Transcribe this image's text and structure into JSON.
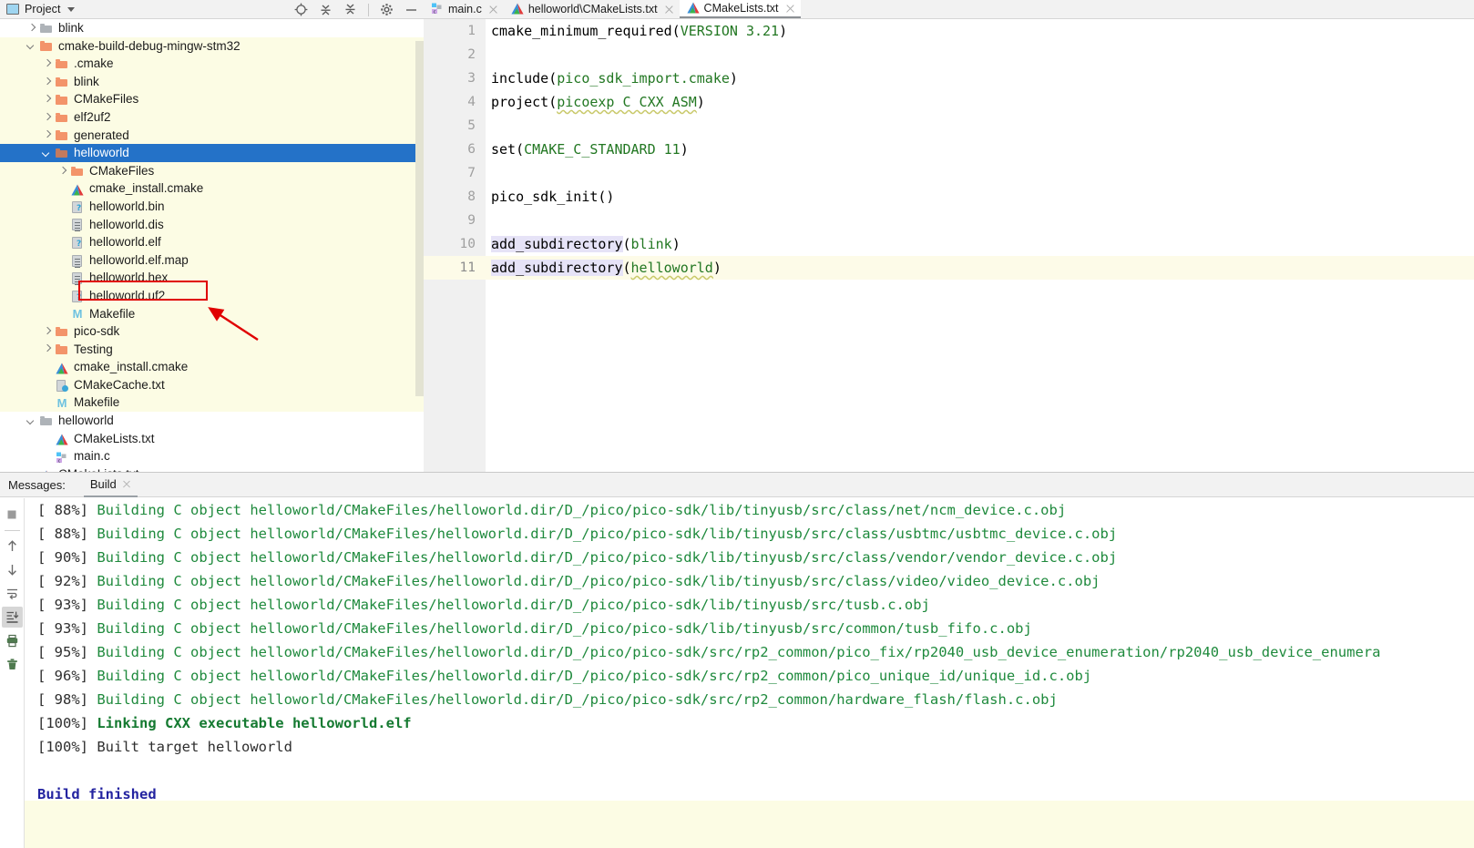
{
  "project_panel": {
    "title": "Project",
    "icons": [
      "project-window-icon",
      "chevron-down-icon",
      "locate-icon",
      "expand-all-icon",
      "collapse-all-icon",
      "gear-icon",
      "minimize-icon"
    ],
    "tree": [
      {
        "label": "blink",
        "icon": "folder-gray",
        "indent": 1,
        "arrow": "right",
        "state": "normal"
      },
      {
        "label": "cmake-build-debug-mingw-stm32",
        "icon": "folder-orange",
        "indent": 1,
        "arrow": "down",
        "state": "shaded"
      },
      {
        "label": ".cmake",
        "icon": "folder-orange",
        "indent": 2,
        "arrow": "right",
        "state": "shaded"
      },
      {
        "label": "blink",
        "icon": "folder-orange",
        "indent": 2,
        "arrow": "right",
        "state": "shaded"
      },
      {
        "label": "CMakeFiles",
        "icon": "folder-orange",
        "indent": 2,
        "arrow": "right",
        "state": "shaded"
      },
      {
        "label": "elf2uf2",
        "icon": "folder-orange",
        "indent": 2,
        "arrow": "right",
        "state": "shaded"
      },
      {
        "label": "generated",
        "icon": "folder-orange",
        "indent": 2,
        "arrow": "right",
        "state": "shaded"
      },
      {
        "label": "helloworld",
        "icon": "folder-dim",
        "indent": 2,
        "arrow": "down",
        "state": "selected"
      },
      {
        "label": "CMakeFiles",
        "icon": "folder-orange",
        "indent": 3,
        "arrow": "right",
        "state": "shaded"
      },
      {
        "label": "cmake_install.cmake",
        "icon": "cmake-file-icon",
        "indent": 3,
        "arrow": "none",
        "state": "shaded"
      },
      {
        "label": "helloworld.bin",
        "icon": "unknown-file-icon",
        "indent": 3,
        "arrow": "none",
        "state": "shaded"
      },
      {
        "label": "helloworld.dis",
        "icon": "text-file-icon",
        "indent": 3,
        "arrow": "none",
        "state": "shaded"
      },
      {
        "label": "helloworld.elf",
        "icon": "unknown-file-icon",
        "indent": 3,
        "arrow": "none",
        "state": "shaded"
      },
      {
        "label": "helloworld.elf.map",
        "icon": "text-file-icon",
        "indent": 3,
        "arrow": "none",
        "state": "shaded"
      },
      {
        "label": "helloworld.hex",
        "icon": "text-file-icon",
        "indent": 3,
        "arrow": "none",
        "state": "shaded"
      },
      {
        "label": "helloworld.uf2",
        "icon": "unknown-file-icon",
        "indent": 3,
        "arrow": "none",
        "state": "shaded",
        "highlighted": true
      },
      {
        "label": "Makefile",
        "icon": "makefile-icon",
        "indent": 3,
        "arrow": "none",
        "state": "shaded"
      },
      {
        "label": "pico-sdk",
        "icon": "folder-orange",
        "indent": 2,
        "arrow": "right",
        "state": "shaded"
      },
      {
        "label": "Testing",
        "icon": "folder-orange",
        "indent": 2,
        "arrow": "right",
        "state": "shaded"
      },
      {
        "label": "cmake_install.cmake",
        "icon": "cmake-file-icon",
        "indent": 2,
        "arrow": "none",
        "state": "shaded"
      },
      {
        "label": "CMakeCache.txt",
        "icon": "cmake-cache-icon",
        "indent": 2,
        "arrow": "none",
        "state": "shaded"
      },
      {
        "label": "Makefile",
        "icon": "makefile-icon",
        "indent": 2,
        "arrow": "none",
        "state": "shaded"
      },
      {
        "label": "helloworld",
        "icon": "folder-gray",
        "indent": 1,
        "arrow": "down",
        "state": "normal"
      },
      {
        "label": "CMakeLists.txt",
        "icon": "cmake-file-icon",
        "indent": 2,
        "arrow": "none",
        "state": "normal"
      },
      {
        "label": "main.c",
        "icon": "c-file-icon",
        "indent": 2,
        "arrow": "none",
        "state": "normal"
      },
      {
        "label": "CMakeLists.txt",
        "icon": "cmake-file-icon",
        "indent": 1,
        "arrow": "none",
        "state": "normal"
      }
    ],
    "annotation": {
      "type": "red-arrow-pointing-to-uf2",
      "color": "#e00000"
    }
  },
  "editor": {
    "tabs": [
      {
        "label": "main.c",
        "icon": "c-file-icon",
        "active": false
      },
      {
        "label": "helloworld\\CMakeLists.txt",
        "icon": "cmake-file-icon",
        "active": false
      },
      {
        "label": "CMakeLists.txt",
        "icon": "cmake-file-icon",
        "active": true
      }
    ],
    "current_line": 11,
    "lines": [
      {
        "n": "1",
        "tokens": [
          {
            "t": "cmake_minimum_required(",
            "c": "plain"
          },
          {
            "t": "VERSION 3.21",
            "c": "green"
          },
          {
            "t": ")",
            "c": "plain"
          }
        ]
      },
      {
        "n": "2",
        "tokens": []
      },
      {
        "n": "3",
        "tokens": [
          {
            "t": "include(",
            "c": "plain"
          },
          {
            "t": "pico_sdk_import.cmake",
            "c": "green"
          },
          {
            "t": ")",
            "c": "plain"
          }
        ]
      },
      {
        "n": "4",
        "tokens": [
          {
            "t": "project(",
            "c": "plain"
          },
          {
            "t": "picoexp C CXX ASM",
            "c": "green-squiggle"
          },
          {
            "t": ")",
            "c": "plain"
          }
        ]
      },
      {
        "n": "5",
        "tokens": []
      },
      {
        "n": "6",
        "tokens": [
          {
            "t": "set(",
            "c": "plain"
          },
          {
            "t": "CMAKE_C_STANDARD 11",
            "c": "green"
          },
          {
            "t": ")",
            "c": "plain"
          }
        ]
      },
      {
        "n": "7",
        "tokens": []
      },
      {
        "n": "8",
        "tokens": [
          {
            "t": "pico_sdk_init()",
            "c": "plain"
          }
        ]
      },
      {
        "n": "9",
        "tokens": []
      },
      {
        "n": "10",
        "tokens": [
          {
            "t": "add_subdirectory",
            "c": "plain-hl"
          },
          {
            "t": "(",
            "c": "plain"
          },
          {
            "t": "blink",
            "c": "green"
          },
          {
            "t": ")",
            "c": "plain"
          }
        ]
      },
      {
        "n": "11",
        "tokens": [
          {
            "t": "add_subdirectory",
            "c": "plain-hl"
          },
          {
            "t": "(",
            "c": "plain"
          },
          {
            "t": "helloworld",
            "c": "green-squiggle"
          },
          {
            "t": ")",
            "c": "plain"
          }
        ]
      }
    ]
  },
  "messages_panel": {
    "label": "Messages:",
    "tab": "Build",
    "toolbar_icons": [
      "stop-icon",
      "up-arrow-icon",
      "down-arrow-icon",
      "soft-wrap-icon",
      "scroll-to-end-icon",
      "print-icon",
      "delete-icon"
    ],
    "log": [
      {
        "pct": "[ 88%]",
        "body": "Building C object helloworld/CMakeFiles/helloworld.dir/D_/pico/pico-sdk/lib/tinyusb/src/class/net/ncm_device.c.obj",
        "style": "green"
      },
      {
        "pct": "[ 88%]",
        "body": "Building C object helloworld/CMakeFiles/helloworld.dir/D_/pico/pico-sdk/lib/tinyusb/src/class/usbtmc/usbtmc_device.c.obj",
        "style": "green"
      },
      {
        "pct": "[ 90%]",
        "body": "Building C object helloworld/CMakeFiles/helloworld.dir/D_/pico/pico-sdk/lib/tinyusb/src/class/vendor/vendor_device.c.obj",
        "style": "green"
      },
      {
        "pct": "[ 92%]",
        "body": "Building C object helloworld/CMakeFiles/helloworld.dir/D_/pico/pico-sdk/lib/tinyusb/src/class/video/video_device.c.obj",
        "style": "green"
      },
      {
        "pct": "[ 93%]",
        "body": "Building C object helloworld/CMakeFiles/helloworld.dir/D_/pico/pico-sdk/lib/tinyusb/src/tusb.c.obj",
        "style": "green"
      },
      {
        "pct": "[ 93%]",
        "body": "Building C object helloworld/CMakeFiles/helloworld.dir/D_/pico/pico-sdk/lib/tinyusb/src/common/tusb_fifo.c.obj",
        "style": "green"
      },
      {
        "pct": "[ 95%]",
        "body": "Building C object helloworld/CMakeFiles/helloworld.dir/D_/pico/pico-sdk/src/rp2_common/pico_fix/rp2040_usb_device_enumeration/rp2040_usb_device_enumera",
        "style": "green"
      },
      {
        "pct": "[ 96%]",
        "body": "Building C object helloworld/CMakeFiles/helloworld.dir/D_/pico/pico-sdk/src/rp2_common/pico_unique_id/unique_id.c.obj",
        "style": "green"
      },
      {
        "pct": "[ 98%]",
        "body": "Building C object helloworld/CMakeFiles/helloworld.dir/D_/pico/pico-sdk/src/rp2_common/hardware_flash/flash.c.obj",
        "style": "green"
      },
      {
        "pct": "[100%]",
        "body": "Linking CXX executable helloworld.elf",
        "style": "green-bold"
      },
      {
        "pct": "[100%]",
        "body": "Built target helloworld",
        "style": "dark"
      },
      {
        "pct": "",
        "body": "",
        "style": "blank"
      },
      {
        "pct": "",
        "body": "Build finished",
        "style": "finished"
      }
    ]
  },
  "colors": {
    "selection_blue": "#2472c8",
    "shaded_yellow": "#fcfce4",
    "log_green": "#1f8a3d",
    "finished_blue": "#2323a0",
    "annotation_red": "#e00000",
    "folder_orange": "#f3946a"
  }
}
